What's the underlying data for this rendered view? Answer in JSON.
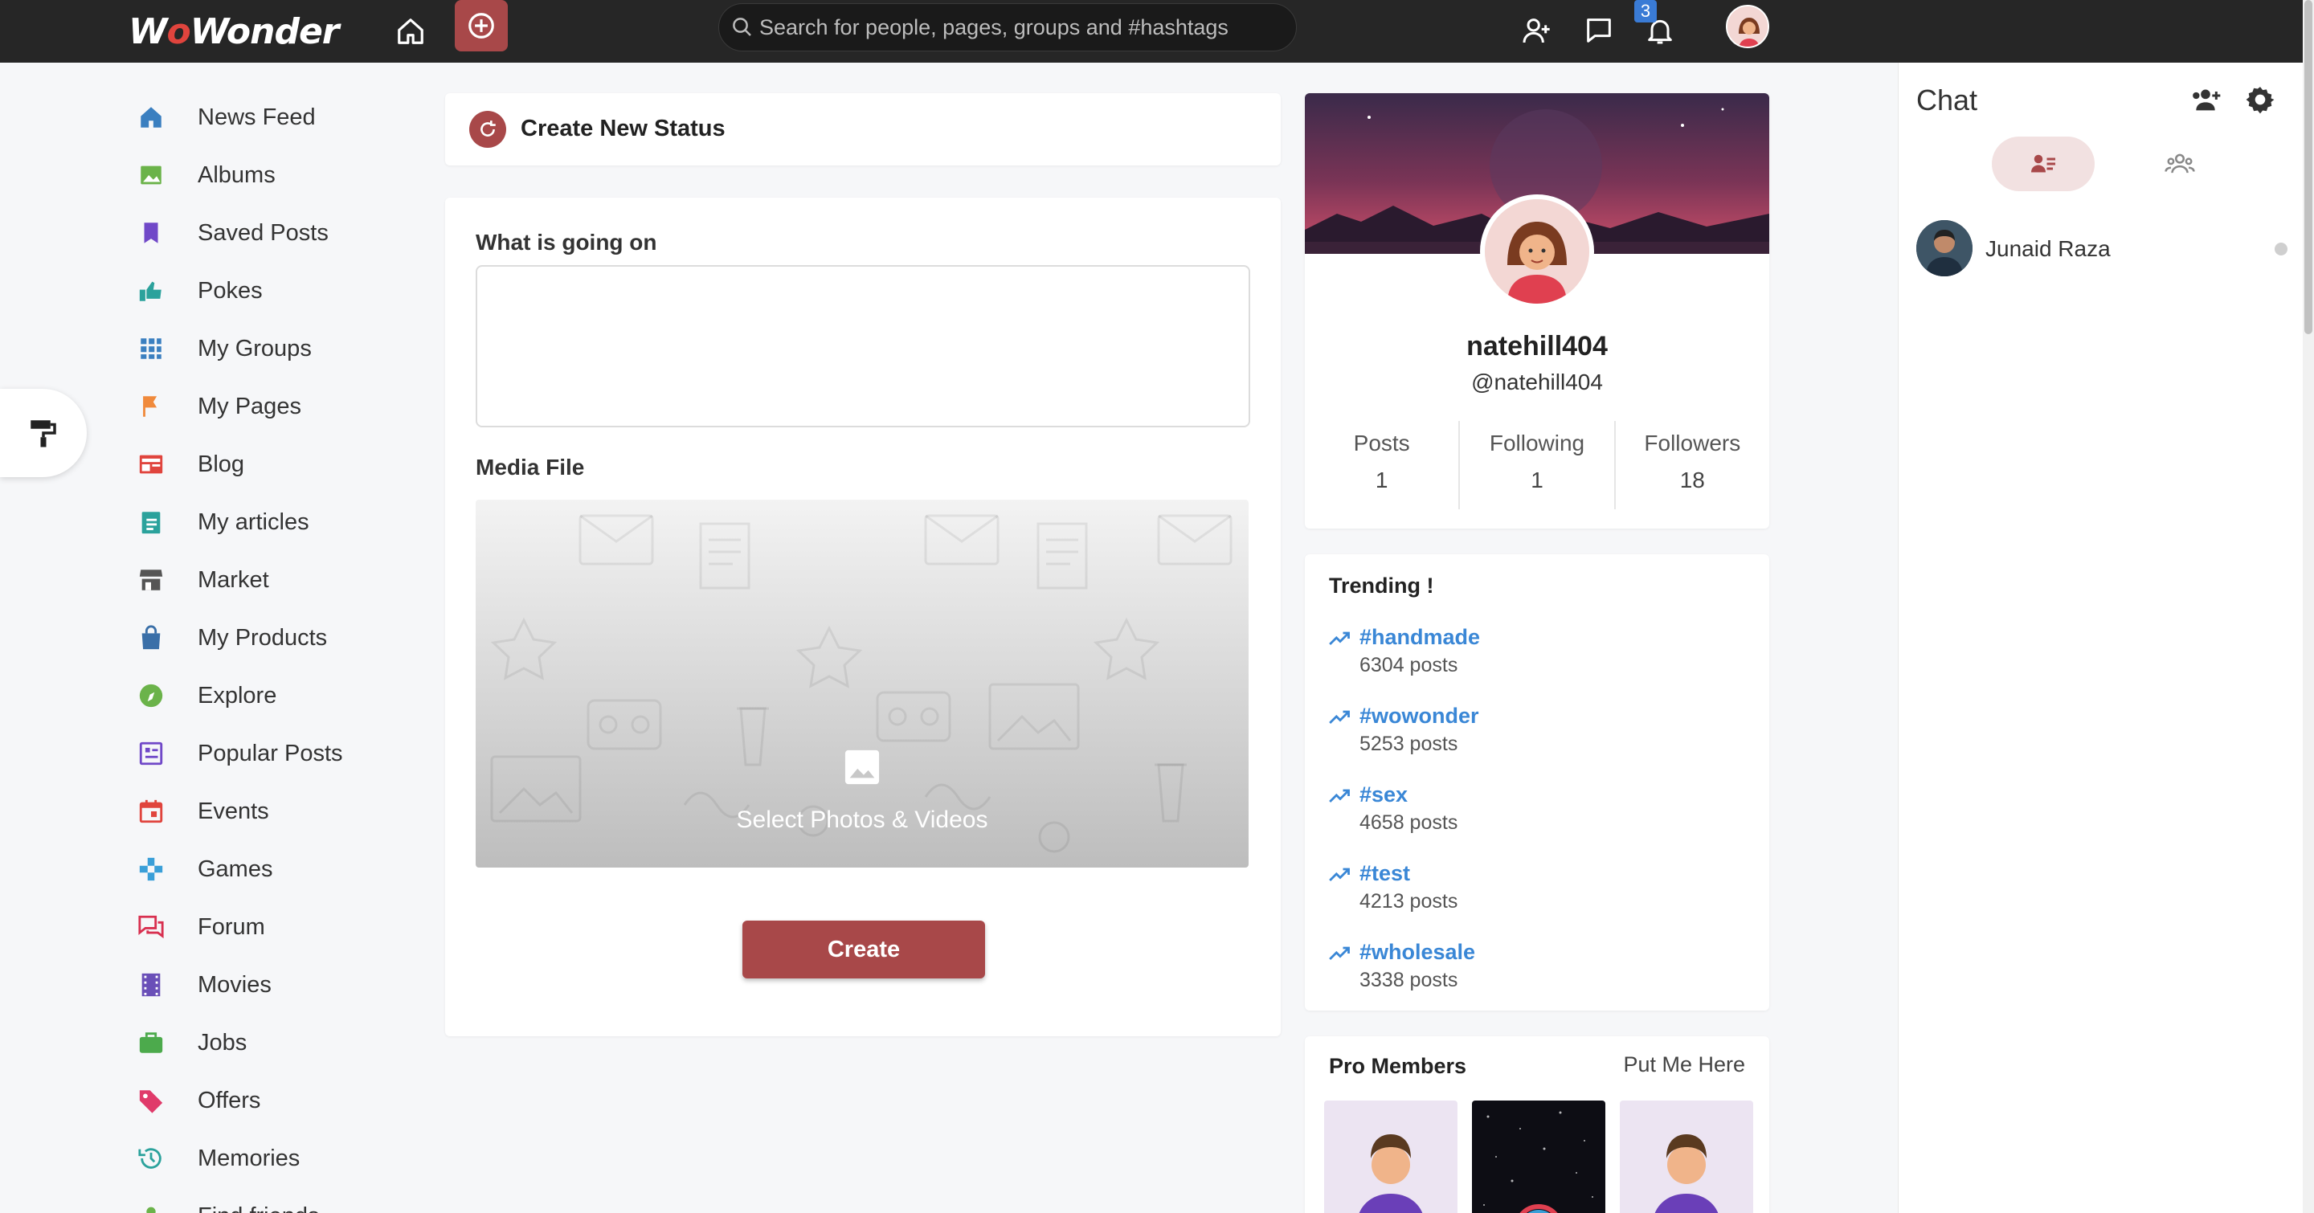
{
  "colors": {
    "accent": "#a84849",
    "topbar": "#262626",
    "link": "#3a87d6"
  },
  "header": {
    "logo_pre": "W",
    "logo_accent": "o",
    "logo_post": "Wonder",
    "search_placeholder": "Search for people, pages, groups and #hashtags",
    "notification_count": "3"
  },
  "sidebar": {
    "items": [
      {
        "label": "News Feed",
        "icon": "home-icon",
        "color": "#3a7fc0"
      },
      {
        "label": "Albums",
        "icon": "image-icon",
        "color": "#6bb34a"
      },
      {
        "label": "Saved Posts",
        "icon": "bookmark-icon",
        "color": "#7048c8"
      },
      {
        "label": "Pokes",
        "icon": "hand-point-icon",
        "color": "#2ba29c"
      },
      {
        "label": "My Groups",
        "icon": "grid-icon",
        "color": "#3a7fc0"
      },
      {
        "label": "My Pages",
        "icon": "flag-icon",
        "color": "#f08a3c"
      },
      {
        "label": "Blog",
        "icon": "newspaper-icon",
        "color": "#e0443d"
      },
      {
        "label": "My articles",
        "icon": "clipboard-icon",
        "color": "#2ba29c"
      },
      {
        "label": "Market",
        "icon": "store-icon",
        "color": "#555555"
      },
      {
        "label": "My Products",
        "icon": "shopping-bag-icon",
        "color": "#3a6fa8"
      },
      {
        "label": "Explore",
        "icon": "compass-icon",
        "color": "#6bb34a"
      },
      {
        "label": "Popular Posts",
        "icon": "list-box-icon",
        "color": "#7048c8"
      },
      {
        "label": "Events",
        "icon": "calendar-icon",
        "color": "#e0443d"
      },
      {
        "label": "Games",
        "icon": "gamepad-icon",
        "color": "#3a9fd8"
      },
      {
        "label": "Forum",
        "icon": "forum-icon",
        "color": "#d83050"
      },
      {
        "label": "Movies",
        "icon": "film-icon",
        "color": "#6a4fb8"
      },
      {
        "label": "Jobs",
        "icon": "briefcase-icon",
        "color": "#4caa4c"
      },
      {
        "label": "Offers",
        "icon": "tag-icon",
        "color": "#e03a6a"
      },
      {
        "label": "Memories",
        "icon": "history-icon",
        "color": "#2ba29c"
      },
      {
        "label": "Find friends",
        "icon": "user-icon",
        "color": "#6bb34a"
      }
    ]
  },
  "create": {
    "title": "Create New Status",
    "what_label": "What is going on",
    "media_label": "Media File",
    "media_select": "Select Photos & Videos",
    "create_button": "Create"
  },
  "profile": {
    "name": "natehill404",
    "handle": "@natehill404",
    "stats": [
      {
        "label": "Posts",
        "value": "1"
      },
      {
        "label": "Following",
        "value": "1"
      },
      {
        "label": "Followers",
        "value": "18"
      }
    ]
  },
  "trending": {
    "title": "Trending !",
    "items": [
      {
        "tag": "#handmade",
        "count": "6304 posts"
      },
      {
        "tag": "#wowonder",
        "count": "5253 posts"
      },
      {
        "tag": "#sex",
        "count": "4658 posts"
      },
      {
        "tag": "#test",
        "count": "4213 posts"
      },
      {
        "tag": "#wholesale",
        "count": "3338 posts"
      }
    ]
  },
  "pro_members": {
    "title": "Pro Members",
    "link": "Put Me Here"
  },
  "chat": {
    "title": "Chat",
    "users": [
      {
        "name": "Junaid Raza",
        "online": false
      }
    ]
  }
}
